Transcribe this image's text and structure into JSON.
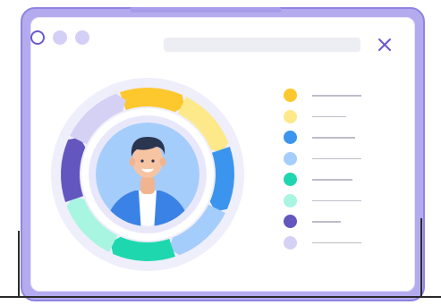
{
  "window": {
    "frame_color": "#b4abee",
    "frame_border": "#8f84e2",
    "controls": [
      {
        "name": "control-dot-1",
        "style": "outline",
        "color": "#6a5ad0"
      },
      {
        "name": "control-dot-2",
        "style": "filled",
        "color": "#d4cff6"
      },
      {
        "name": "control-dot-3",
        "style": "filled",
        "color": "#d4cff6"
      }
    ],
    "close_icon": "close-icon",
    "close_color": "#6a5ad0"
  },
  "profile": {
    "avatar_icon": "person-avatar-icon",
    "ring_segments": [
      {
        "color": "#fdc82d",
        "share": 0.125
      },
      {
        "color": "#fde98a",
        "share": 0.125
      },
      {
        "color": "#3b95ee",
        "share": 0.125
      },
      {
        "color": "#a5cdfb",
        "share": 0.125
      },
      {
        "color": "#1fd7ae",
        "share": 0.125
      },
      {
        "color": "#a8f5e1",
        "share": 0.125
      },
      {
        "color": "#6456bf",
        "share": 0.125
      },
      {
        "color": "#d4d1f4",
        "share": 0.125
      }
    ]
  },
  "legend": [
    {
      "color": "#fdc82d",
      "line_fraction": 0.55
    },
    {
      "color": "#fde98a",
      "line_fraction": 0.38
    },
    {
      "color": "#3b95ee",
      "line_fraction": 0.48
    },
    {
      "color": "#a5cdfb",
      "line_fraction": 0.55
    },
    {
      "color": "#1fd7ae",
      "line_fraction": 0.45
    },
    {
      "color": "#a8f5e1",
      "line_fraction": 0.55
    },
    {
      "color": "#6456bf",
      "line_fraction": 0.32
    },
    {
      "color": "#d4d1f4",
      "line_fraction": 0.55
    }
  ]
}
